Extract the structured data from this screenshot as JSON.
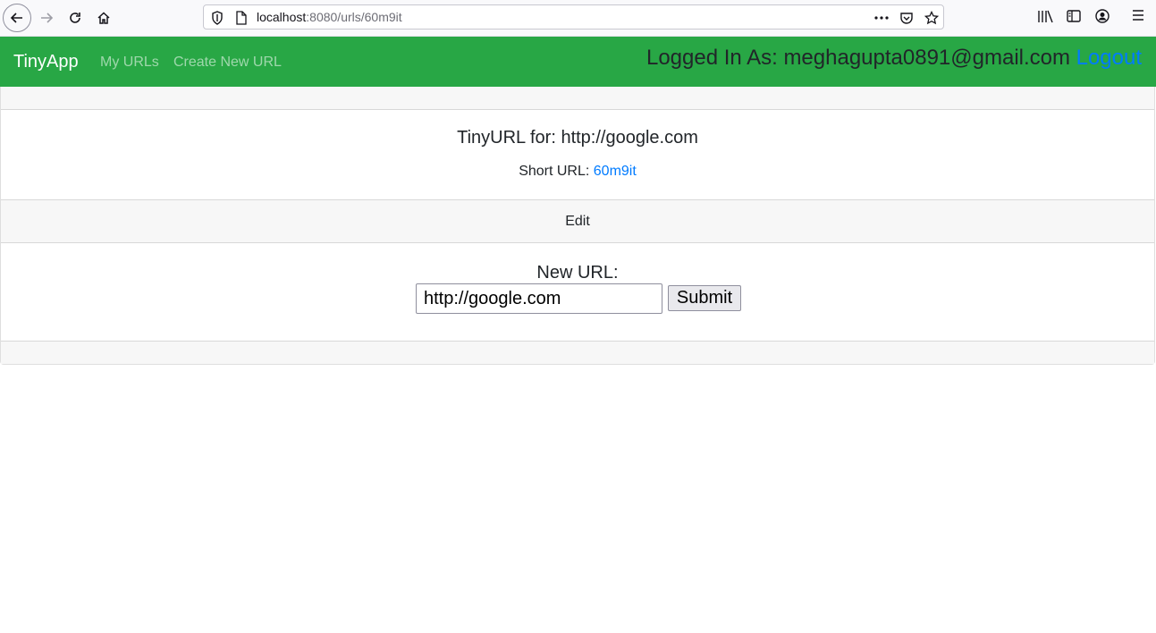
{
  "browser": {
    "url_host": "localhost",
    "url_rest": ":8080/urls/60m9it"
  },
  "navbar": {
    "brand": "TinyApp",
    "links": [
      "My URLs",
      "Create New URL"
    ],
    "logged_in_text": "Logged In As: meghagupta0891@gmail.com",
    "logout_label": "Logout"
  },
  "card": {
    "title": "TinyURL for: http://google.com",
    "short_url_label": "Short URL:",
    "short_url_value": "60m9it",
    "edit_header": "Edit",
    "new_url_label": "New URL:",
    "new_url_value": "http://google.com",
    "submit_label": "Submit"
  },
  "colors": {
    "navbar": "#28a745",
    "link": "#007bff"
  },
  "icons": [
    "back-arrow-icon",
    "forward-arrow-icon",
    "reload-icon",
    "home-icon",
    "shield-icon",
    "page-icon",
    "more-icon",
    "pocket-icon",
    "star-icon",
    "library-icon",
    "sidebar-icon",
    "account-icon",
    "menu-icon"
  ]
}
